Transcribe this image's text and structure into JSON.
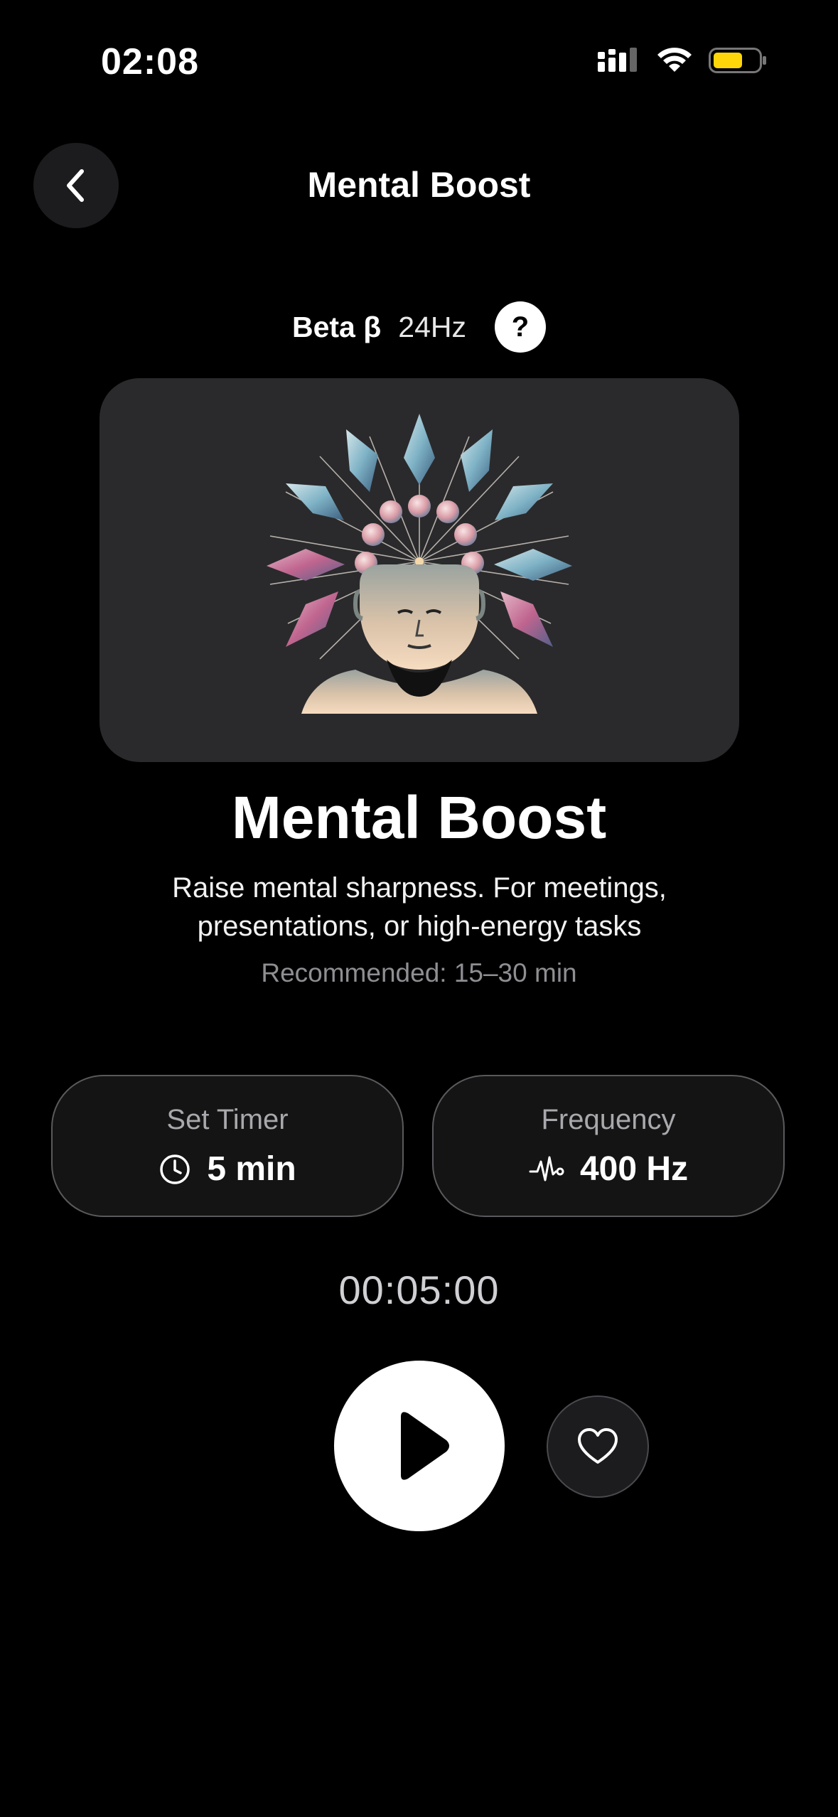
{
  "status_bar": {
    "time": "02:08",
    "signal_icon": "cellular-signal-icon",
    "wifi_icon": "wifi-icon",
    "battery_icon": "battery-icon",
    "battery_color": "#FFD60A"
  },
  "header": {
    "back_icon": "chevron-left-icon",
    "title": "Mental Boost"
  },
  "wave": {
    "name": "Beta β",
    "frequency": "24Hz",
    "help_label": "?"
  },
  "hero": {
    "illustration": "head-crystal-crown-illustration"
  },
  "session": {
    "title": "Mental Boost",
    "description": "Raise mental sharpness. For meetings, presentations, or high-energy tasks",
    "recommended": "Recommended: 15–30 min"
  },
  "settings": {
    "timer": {
      "label": "Set Timer",
      "value": "5 min",
      "icon": "clock-icon"
    },
    "frequency": {
      "label": "Frequency",
      "value": "400 Hz",
      "icon": "waveform-icon"
    }
  },
  "player": {
    "countdown": "00:05:00",
    "play_icon": "play-icon",
    "favorite_icon": "heart-icon"
  },
  "colors": {
    "background": "#000000",
    "surface": "#1C1C1E",
    "card": "#2A2A2C",
    "accent": "#FFFFFF"
  }
}
